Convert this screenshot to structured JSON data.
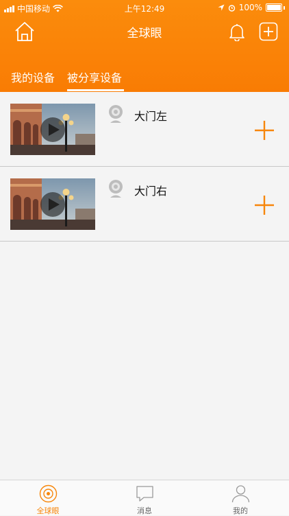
{
  "status_bar": {
    "carrier": "中国移动",
    "time": "上午12:49",
    "battery": "100%"
  },
  "nav": {
    "title": "全球眼"
  },
  "tabs": [
    {
      "label": "我的设备"
    },
    {
      "label": "被分享设备"
    }
  ],
  "devices": [
    {
      "name": "大门左"
    },
    {
      "name": "大门右"
    }
  ],
  "tabbar": [
    {
      "label": "全球眼"
    },
    {
      "label": "消息"
    },
    {
      "label": "我的"
    }
  ],
  "colors": {
    "accent": "#f7860b",
    "header": "#f97c04",
    "background": "#f4f4f4"
  }
}
